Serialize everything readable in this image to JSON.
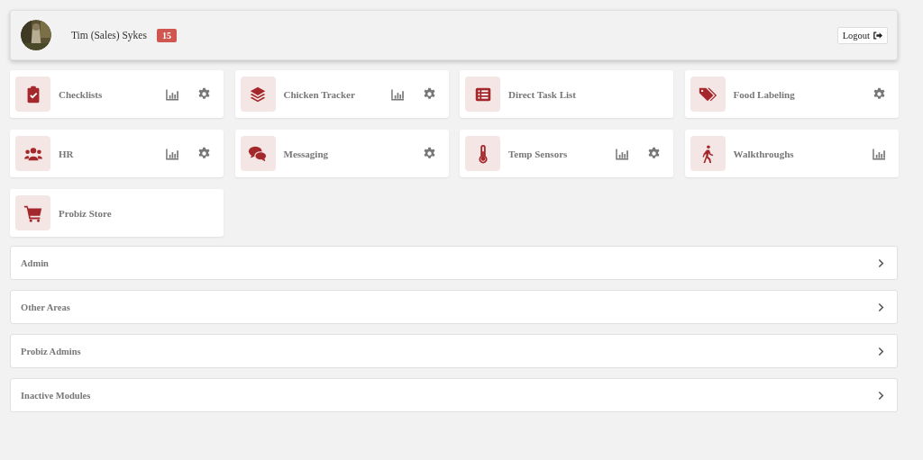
{
  "header": {
    "user_name": "Tim (Sales) Sykes",
    "badge": "15",
    "logout": "Logout"
  },
  "modules": [
    {
      "label": "Checklists",
      "kind": "clipboard",
      "stats": true,
      "settings": true
    },
    {
      "label": "Chicken Tracker",
      "kind": "layers",
      "stats": true,
      "settings": true
    },
    {
      "label": "Direct Task List",
      "kind": "list",
      "stats": false,
      "settings": false
    },
    {
      "label": "Food Labeling",
      "kind": "tags",
      "stats": false,
      "settings": true
    },
    {
      "label": "HR",
      "kind": "users",
      "stats": true,
      "settings": true
    },
    {
      "label": "Messaging",
      "kind": "comments",
      "stats": false,
      "settings": true
    },
    {
      "label": "Temp Sensors",
      "kind": "thermometer",
      "stats": true,
      "settings": true
    },
    {
      "label": "Walkthroughs",
      "kind": "walking",
      "stats": true,
      "settings": false
    },
    {
      "label": "Probiz Store",
      "kind": "cart",
      "stats": false,
      "settings": false
    }
  ],
  "sections": [
    {
      "label": "Admin",
      "expanded": false
    },
    {
      "label": "Other Areas",
      "expanded": false
    },
    {
      "label": "Probiz Admins",
      "expanded": false
    },
    {
      "label": "Inactive Modules",
      "expanded": false
    }
  ]
}
